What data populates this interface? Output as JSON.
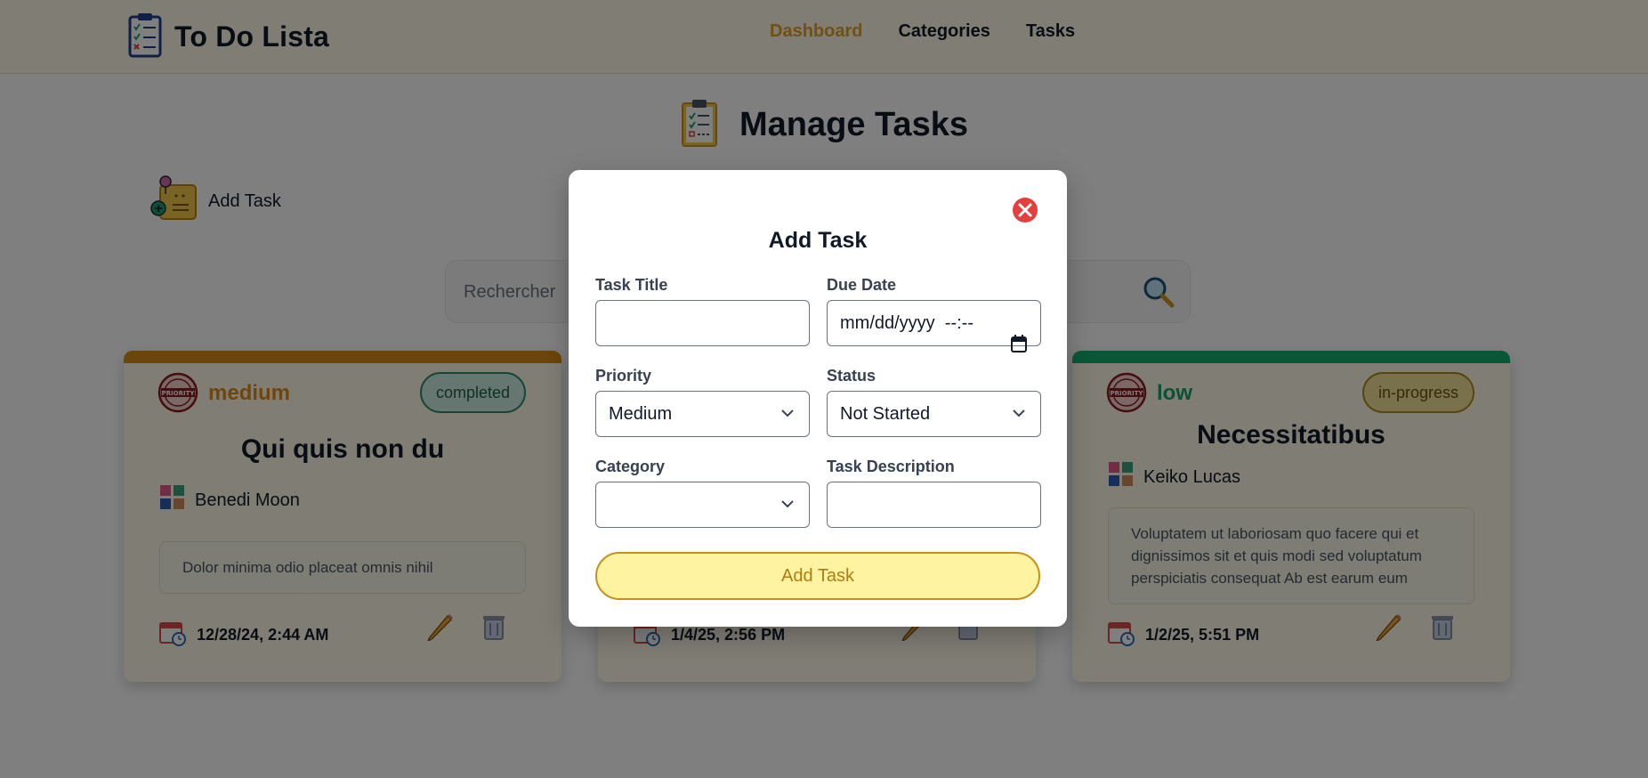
{
  "app": {
    "title": "To Do Lista",
    "nav": [
      {
        "label": "Dashboard",
        "active": true
      },
      {
        "label": "Categories",
        "active": false
      },
      {
        "label": "Tasks",
        "active": false
      }
    ]
  },
  "page": {
    "title": "Manage Tasks",
    "add_task_label": "Add Task",
    "search_placeholder": "Rechercher"
  },
  "cards": [
    {
      "priority": "medium",
      "priority_color": "#e08a14",
      "bar_color": "#d88b10",
      "status": "completed",
      "status_bg": "#cdeee3",
      "status_border": "#2e8c6a",
      "status_text": "#1d5f48",
      "title": "Qui quis non du",
      "category": "Benedi Moon",
      "description": "Dolor minima odio placeat omnis nihil",
      "date": "12/28/24, 2:44 AM"
    },
    {
      "priority": "",
      "title": "",
      "category": "",
      "description": "",
      "date": "1/4/25, 2:56 PM"
    },
    {
      "priority": "low",
      "priority_color": "#13a56a",
      "bar_color": "#10b070",
      "status": "in-progress",
      "status_bg": "#f3e398",
      "status_border": "#b08a1c",
      "status_text": "#6b5210",
      "title": "Necessitatibus",
      "category": "Keiko Lucas",
      "description": "Voluptatem ut laboriosam quo facere qui et dignissimos sit et quis modi sed voluptatum perspiciatis consequat Ab est earum eum",
      "date": "1/2/25, 5:51 PM"
    }
  ],
  "modal": {
    "title": "Add Task",
    "task_title_label": "Task Title",
    "task_title_value": "",
    "due_date_label": "Due Date",
    "due_date_value": "mm/dd/yyyy  --:--",
    "priority_label": "Priority",
    "priority_value": "Medium",
    "status_label": "Status",
    "status_value": "Not Started",
    "category_label": "Category",
    "category_value": "",
    "description_label": "Task Description",
    "description_value": "",
    "submit_label": "Add Task"
  },
  "icons": {
    "logo": "clipboard-checklist-icon",
    "search": "search-magnifier-icon",
    "close": "close-circle-icon",
    "priority": "priority-stamp-icon",
    "category": "category-grid-icon",
    "date": "calendar-clock-icon",
    "edit": "pencil-icon",
    "delete": "trash-icon"
  }
}
